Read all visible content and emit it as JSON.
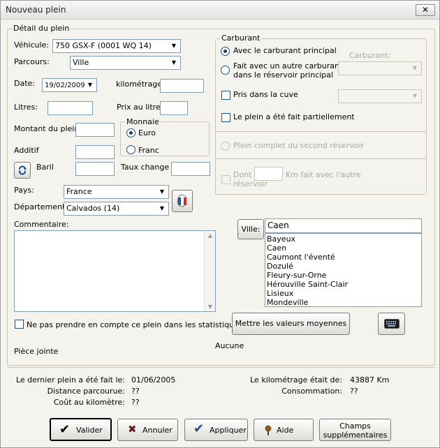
{
  "window": {
    "title": "Nouveau plein",
    "close_glyph": "✕"
  },
  "detail": {
    "legend": "Détail du plein",
    "vehicule_label": "Véhicule:",
    "vehicule_value": "750 GSX-F (0001 WQ 14)",
    "parcours_label": "Parcours:",
    "parcours_value": "Ville",
    "date_label": "Date:",
    "date_value": "19/02/2009",
    "kilometrage_label": "kilométrage :",
    "kilometrage_value": "",
    "litres_label": "Litres:",
    "litres_value": "",
    "prix_label": "Prix au litre:",
    "prix_value": "",
    "montant_label": "Montant du plein:",
    "montant_value": "",
    "monnaie_legend": "Monnaie",
    "euro_label": "Euro",
    "franc_label": "Franc",
    "additif_label": "Additif",
    "additif_value": "",
    "baril_label": "Baril",
    "baril_value": "",
    "taux_label": "Taux change",
    "taux_value": "",
    "pays_label": "Pays:",
    "pays_value": "France",
    "departement_label": "Département:",
    "departement_value": "Calvados (14)",
    "commentaire_label": "Commentaire:",
    "commentaire_value": "",
    "stats_label": "Ne pas prendre en compte ce plein dans les statistiques",
    "piece_label": "Pièce jointe",
    "piece_value": "Aucune"
  },
  "carburant": {
    "legend": "Carburant",
    "principal_label": "Avec le carburant principal",
    "autre_label_1": "Fait avec un autre carburant",
    "autre_label_2": "dans le réservoir principal",
    "carburant_field_label": "Carburant:",
    "cuve_label": "Pris dans la cuve",
    "partiel_label": "Le plein a été fait partiellement",
    "second_label": "Plein complet du second réservoir",
    "dont_label": "Dont",
    "km_label_1": "Km fait avec l'autre",
    "km_label_2": "réservoir"
  },
  "ville": {
    "button_label": "Ville:",
    "value": "Caen",
    "options": [
      "Bayeux",
      "Caen",
      "Caumont l'éventé",
      "Dozulé",
      "Fleury-sur-Orne",
      "Hérouville Saint-Clair",
      "Lisieux",
      "Mondeville"
    ]
  },
  "moyennes_label": "Mettre les valeurs moyennes",
  "summary": {
    "dernier_label": "Le dernier plein a été fait le:",
    "dernier_value": "01/06/2005",
    "distance_label": "Distance parcourue:",
    "distance_value": "??",
    "cout_label": "Coût au kilomètre:",
    "cout_value": "??",
    "km_label": "Le kilométrage était de:",
    "km_value": "43887 Km",
    "conso_label": "Consommation:",
    "conso_value": "??"
  },
  "buttons": {
    "valider": "Valider",
    "annuler": "Annuler",
    "appliquer": "Appliquer",
    "aide": "Aide",
    "champs_1": "Champs",
    "champs_2": "supplémentaires"
  }
}
